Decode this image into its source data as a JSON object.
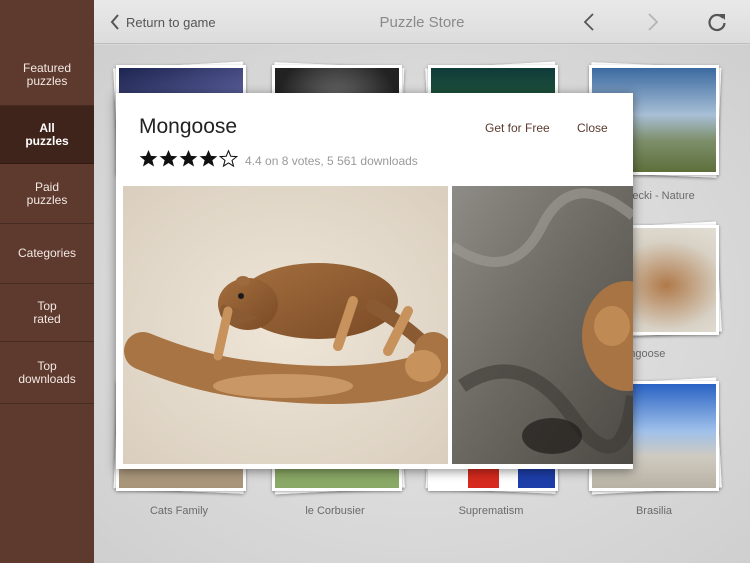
{
  "sidebar": {
    "items": [
      {
        "label": "Featured\npuzzles",
        "active": false
      },
      {
        "label": "All\npuzzles",
        "active": true
      },
      {
        "label": "Paid\npuzzles",
        "active": false
      },
      {
        "label": "Categories",
        "active": false
      },
      {
        "label": "Top\nrated",
        "active": false
      },
      {
        "label": "Top\ndownloads",
        "active": false
      }
    ]
  },
  "header": {
    "back_label": "Return to game",
    "title": "Puzzle Store",
    "icons": [
      "chevron-left-icon",
      "chevron-right-icon",
      "reload-icon"
    ]
  },
  "grid": {
    "labels_mid": [
      "Bielecki - Nature",
      "Mongoose"
    ],
    "labels_bottom": [
      "Cats Family",
      "le Corbusier",
      "Suprematism",
      "Brasilia"
    ]
  },
  "modal": {
    "title": "Mongoose",
    "get_label": "Get for Free",
    "close_label": "Close",
    "rating": 4.4,
    "rating_text": "4.4 on 8 votes, 5 561 downloads"
  },
  "colors": {
    "sidebar": "#5e3a2e",
    "sidebar_active": "#3f241b",
    "accent_text": "#5b3a2f"
  }
}
